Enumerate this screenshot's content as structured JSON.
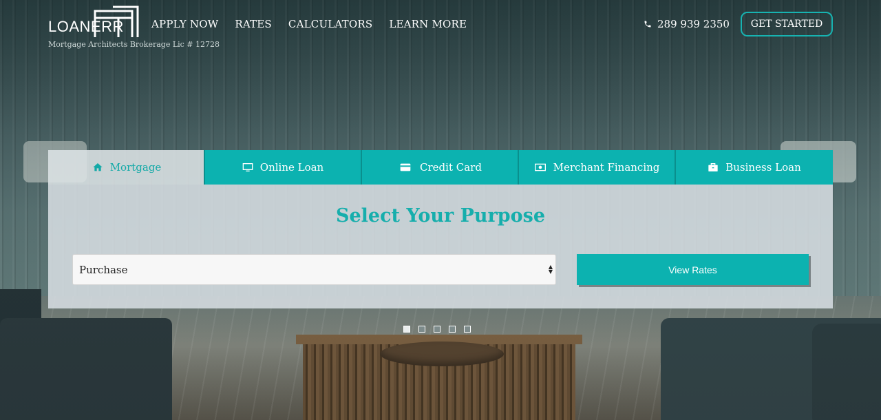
{
  "header": {
    "logo_text": "LOANERR",
    "license": "Mortgage Architects Brokerage Lic # 12728",
    "nav": [
      "APPLY NOW",
      "RATES",
      "CALCULATORS",
      "LEARN MORE"
    ],
    "phone": "289 939 2350",
    "cta": "GET STARTED"
  },
  "tabs": [
    {
      "label": "Mortgage",
      "icon": "home-icon",
      "active": true
    },
    {
      "label": "Online Loan",
      "icon": "monitor-icon",
      "active": false
    },
    {
      "label": "Credit Card",
      "icon": "credit-card-icon",
      "active": false
    },
    {
      "label": "Merchant Financing",
      "icon": "money-icon",
      "active": false
    },
    {
      "label": "Business Loan",
      "icon": "briefcase-icon",
      "active": false
    }
  ],
  "panel": {
    "title": "Select Your Purpose",
    "select_value": "Purchase",
    "button": "View Rates"
  },
  "slider": {
    "count": 5,
    "active_index": 0
  },
  "colors": {
    "accent": "#0cb2b0",
    "panel_bg": "#d6dde1"
  }
}
